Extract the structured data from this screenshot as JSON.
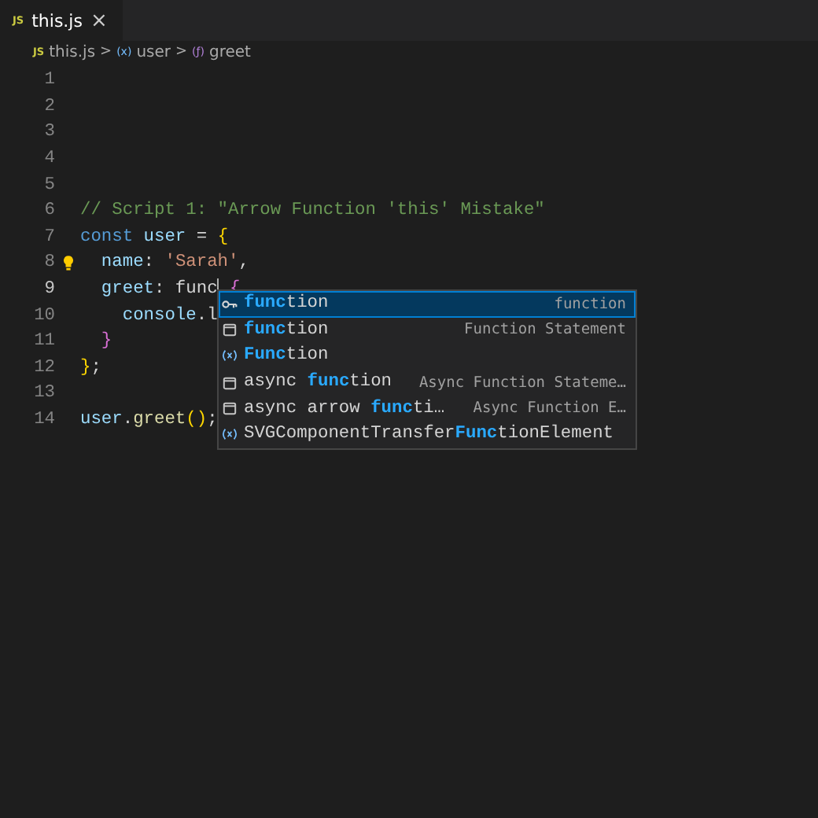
{
  "tabs": [
    {
      "icon": "JS",
      "label": "this.js",
      "close": "×",
      "selected": true
    }
  ],
  "breadcrumb": [
    {
      "kind": "file",
      "icon": "JS",
      "label": "this.js"
    },
    {
      "kind": "variable",
      "icon": "(x)",
      "label": "user"
    },
    {
      "kind": "method",
      "icon": "(ƒ)",
      "label": "greet"
    }
  ],
  "breadcrumb_separator": ">",
  "lines": [
    {
      "number": "1",
      "current": false
    },
    {
      "number": "2",
      "current": false
    },
    {
      "number": "3",
      "current": false
    },
    {
      "number": "4",
      "current": false
    },
    {
      "number": "5",
      "current": false
    },
    {
      "number": "6",
      "current": false,
      "tokens": [
        {
          "kind": "comment",
          "text": "// Script 1: \"Arrow Function 'this' Mistake\""
        }
      ]
    },
    {
      "number": "7",
      "current": false,
      "tokens": [
        {
          "kind": "keyword",
          "text": "const"
        },
        {
          "kind": "variable",
          "text": " user"
        },
        {
          "kind": "plain",
          "text": " = "
        },
        {
          "kind": "brace",
          "text": "{"
        }
      ]
    },
    {
      "number": "8",
      "current": false,
      "lightbulb": true,
      "tokens": [
        {
          "kind": "property",
          "text": "  name"
        },
        {
          "kind": "plain",
          "text": ": "
        },
        {
          "kind": "string",
          "text": "'Sarah'"
        },
        {
          "kind": "plain",
          "text": ","
        }
      ]
    },
    {
      "number": "9",
      "current": true,
      "cursor": true,
      "tokens": [
        {
          "kind": "property",
          "text": "  greet"
        },
        {
          "kind": "plain",
          "text": ": func"
        }
      ],
      "after_cursor": [
        {
          "kind": "brace2",
          "text": " {"
        }
      ]
    },
    {
      "number": "10",
      "current": false,
      "tokens": [
        {
          "kind": "variable",
          "text": "    console"
        },
        {
          "kind": "plain",
          "text": ".l"
        }
      ]
    },
    {
      "number": "11",
      "current": false,
      "tokens": [
        {
          "kind": "brace2",
          "text": "  }"
        }
      ]
    },
    {
      "number": "12",
      "current": false,
      "tokens": [
        {
          "kind": "brace",
          "text": "}"
        },
        {
          "kind": "plain",
          "text": ";"
        }
      ]
    },
    {
      "number": "13",
      "current": false
    },
    {
      "number": "14",
      "current": false,
      "tokens": [
        {
          "kind": "variable",
          "text": "user"
        },
        {
          "kind": "plain",
          "text": "."
        },
        {
          "kind": "function",
          "text": "greet"
        },
        {
          "kind": "brace",
          "text": "()"
        },
        {
          "kind": "plain",
          "text": ";"
        }
      ]
    }
  ],
  "suggestions": [
    {
      "kind": "keyword",
      "match": "func",
      "after": "tion",
      "detail": "function",
      "selected": true
    },
    {
      "kind": "snippet",
      "match": "func",
      "after": "tion",
      "detail": "Function Statement",
      "selected": false
    },
    {
      "kind": "variable",
      "match": "Func",
      "after": "tion",
      "selected": false
    },
    {
      "kind": "snippet",
      "before": "async ",
      "match": "func",
      "after": "tion",
      "detail": "Async Function Stateme…",
      "selected": false
    },
    {
      "kind": "snippet",
      "before": "async arrow ",
      "match": "func",
      "after": "ti…",
      "detail": "Async Function E…",
      "selected": false
    },
    {
      "kind": "variable",
      "before": "SVGComponentTransfer",
      "match": "Func",
      "after": "tionElement",
      "selected": false
    }
  ]
}
